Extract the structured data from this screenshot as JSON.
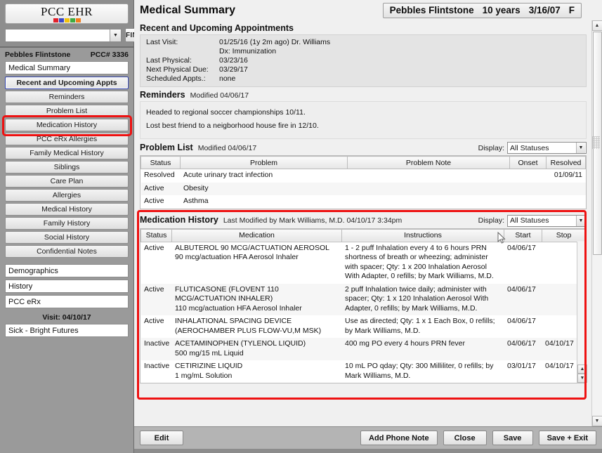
{
  "app": {
    "logo_text": "PCC EHR",
    "logo_colors": [
      "#e2202a",
      "#3b49c8",
      "#f2c20a",
      "#3fab3f",
      "#f07d1e"
    ],
    "find_button": "FIND",
    "search_value": "",
    "search_placeholder": ""
  },
  "sidebar": {
    "patient_name": "Pebbles Flintstone",
    "patient_number": "PCC# 3336",
    "current_chart": "Medical Summary",
    "nav_items": [
      {
        "label": "Recent and Upcoming Appts",
        "selected": true
      },
      {
        "label": "Reminders",
        "selected": false
      },
      {
        "label": "Problem List",
        "selected": false
      },
      {
        "label": "Medication History",
        "selected": false
      },
      {
        "label": "PCC eRx Allergies",
        "selected": false
      },
      {
        "label": "Family Medical History",
        "selected": false
      },
      {
        "label": "Siblings",
        "selected": false
      },
      {
        "label": "Care Plan",
        "selected": false
      },
      {
        "label": "Allergies",
        "selected": false
      },
      {
        "label": "Medical History",
        "selected": false
      },
      {
        "label": "Family History",
        "selected": false
      },
      {
        "label": "Social History",
        "selected": false
      },
      {
        "label": "Confidential Notes",
        "selected": false
      }
    ],
    "chart_sections": [
      {
        "label": "Demographics"
      },
      {
        "label": "History"
      },
      {
        "label": "PCC eRx"
      }
    ],
    "visit_label": "Visit: 04/10/17",
    "visit_items": [
      {
        "label": "Sick - Bright Futures"
      }
    ]
  },
  "header": {
    "page_title": "Medical Summary",
    "patient_name": "Pebbles Flintstone",
    "patient_age": "10 years",
    "patient_dob": "3/16/07",
    "patient_sex": "F"
  },
  "appointments": {
    "title": "Recent and Upcoming Appointments",
    "rows": [
      {
        "label": "Last Visit:",
        "value": "01/25/16 (1y 2m ago)  Dr. Williams"
      },
      {
        "label": "",
        "value": "Dx: Immunization"
      },
      {
        "label": "Last Physical:",
        "value": "03/23/16"
      },
      {
        "label": "Next Physical Due:",
        "value": "03/29/17"
      },
      {
        "label": "Scheduled Appts.:",
        "value": "none"
      }
    ]
  },
  "reminders": {
    "title": "Reminders",
    "modified": "Modified 04/06/17",
    "lines": [
      "Headed to regional soccer championships 10/11.",
      "Lost best friend to a neigborhood house fire in 12/10."
    ]
  },
  "problem_list": {
    "title": "Problem List",
    "modified": "Modified 04/06/17",
    "display_label": "Display:",
    "display_value": "All Statuses",
    "columns": [
      "Status",
      "Problem",
      "Problem Note",
      "Onset",
      "Resolved"
    ],
    "rows": [
      {
        "status": "Resolved",
        "problem": "Acute urinary tract infection",
        "note": "",
        "onset": "",
        "resolved": "01/09/11"
      },
      {
        "status": "Active",
        "problem": "Obesity",
        "note": "",
        "onset": "",
        "resolved": ""
      },
      {
        "status": "Active",
        "problem": "Asthma",
        "note": "",
        "onset": "",
        "resolved": ""
      }
    ]
  },
  "medication_history": {
    "title": "Medication History",
    "modified": "Last Modified by Mark Williams, M.D. 04/10/17 3:34pm",
    "display_label": "Display:",
    "display_value": "All Statuses",
    "columns": [
      "Status",
      "Medication",
      "Instructions",
      "Start",
      "Stop"
    ],
    "rows": [
      {
        "status": "Active",
        "medication": "ALBUTEROL 90 MCG/ACTUATION AEROSOL",
        "medication2": "90 mcg/actuation HFA Aerosol Inhaler",
        "instructions": "1 - 2 puff Inhalation every 4 to 6 hours PRN shortness of breath or wheezing; administer with spacer; Qty: 1 x 200 Inhalation Aerosol With Adapter, 0 refills; by Mark Williams, M.D.",
        "start": "04/06/17",
        "stop": ""
      },
      {
        "status": "Active",
        "medication": "FLUTICASONE (FLOVENT 110 MCG/ACTUATION INHALER)",
        "medication2": "110 mcg/actuation HFA Aerosol Inhaler",
        "instructions": "2 puff Inhalation twice daily; administer with spacer; Qty: 1 x 120 Inhalation Aerosol With Adapter, 0 refills; by Mark Williams, M.D.",
        "start": "04/06/17",
        "stop": ""
      },
      {
        "status": "Active",
        "medication": "INHALATIONAL SPACING DEVICE (AEROCHAMBER PLUS FLOW-VU,M MSK)",
        "medication2": "",
        "instructions": "Use as directed; Qty: 1 x 1 Each Box, 0 refills; by Mark Williams, M.D.",
        "start": "04/06/17",
        "stop": ""
      },
      {
        "status": "Inactive",
        "medication": "ACETAMINOPHEN (TYLENOL LIQUID)",
        "medication2": "500 mg/15 mL Liquid",
        "instructions": "400 mg PO every 4 hours PRN fever",
        "start": "04/06/17",
        "stop": "04/10/17"
      },
      {
        "status": "Inactive",
        "medication": "CETIRIZINE LIQUID",
        "medication2": "1 mg/mL Solution",
        "instructions": "10 mL PO qday; Qty: 300 Milliliter, 0 refills; by Mark Williams, M.D.",
        "start": "03/01/17",
        "stop": "04/10/17"
      }
    ]
  },
  "footer": {
    "edit": "Edit",
    "add_phone_note": "Add Phone Note",
    "close": "Close",
    "save": "Save",
    "save_exit": "Save + Exit"
  },
  "annotations": {
    "highlight_color": "#ee1111"
  }
}
